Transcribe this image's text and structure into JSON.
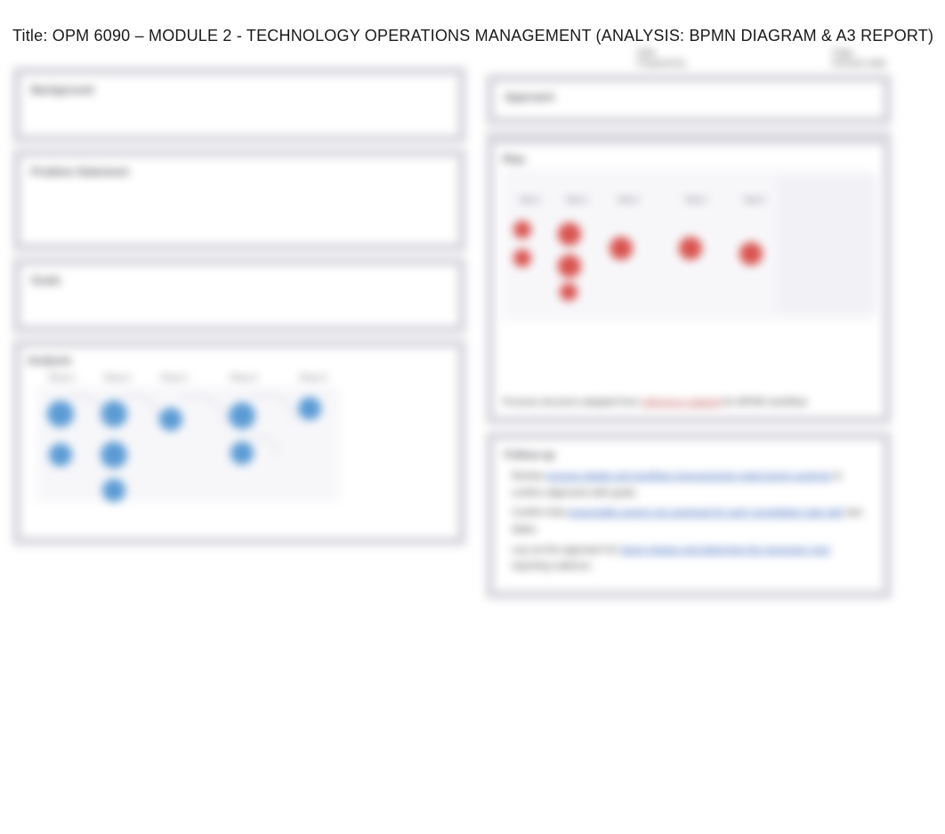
{
  "title": "Title: OPM 6090 – MODULE 2 - TECHNOLOGY OPERATIONS MANAGEMENT (ANALYSIS: BPMN DIAGRAM & A3 REPORT)",
  "meta": {
    "left_label": "Date",
    "left_value": "",
    "left_sub": "Prepared by",
    "right_label": "Page",
    "right_value": "",
    "right_sub": "Revision date"
  },
  "left": {
    "box1": {
      "heading": "Background"
    },
    "box2": {
      "heading": "Problem Statement"
    },
    "box3": {
      "heading": "Goals"
    },
    "box4": {
      "heading": "Analysis",
      "lanes": [
        "Phase 1",
        "Phase 2",
        "Phase 3",
        "Phase 4",
        "Phase 5"
      ]
    }
  },
  "right": {
    "box1": {
      "heading": "Approach"
    },
    "plan": {
      "heading": "Plan",
      "lanes": [
        "Step 1",
        "Step 2",
        "Step 3",
        "Step 4",
        "Step 5"
      ],
      "note_prefix": "Process structure adapted from",
      "note_link": "reference material",
      "note_suffix": "for BPMN workflow."
    },
    "followup": {
      "heading": "Follow-up",
      "items": [
        {
          "prefix": "Review",
          "link": "process details and workflow improvements noted during analysis",
          "suffix": "to confirm alignment with goals."
        },
        {
          "prefix": "Confirm that",
          "link": "responsible owners are assigned for each remediation task with",
          "suffix": "due dates."
        },
        {
          "prefix": "Lay out the approach for",
          "link": "future phases and determine the necessary next",
          "suffix": "reporting cadence."
        }
      ]
    }
  }
}
